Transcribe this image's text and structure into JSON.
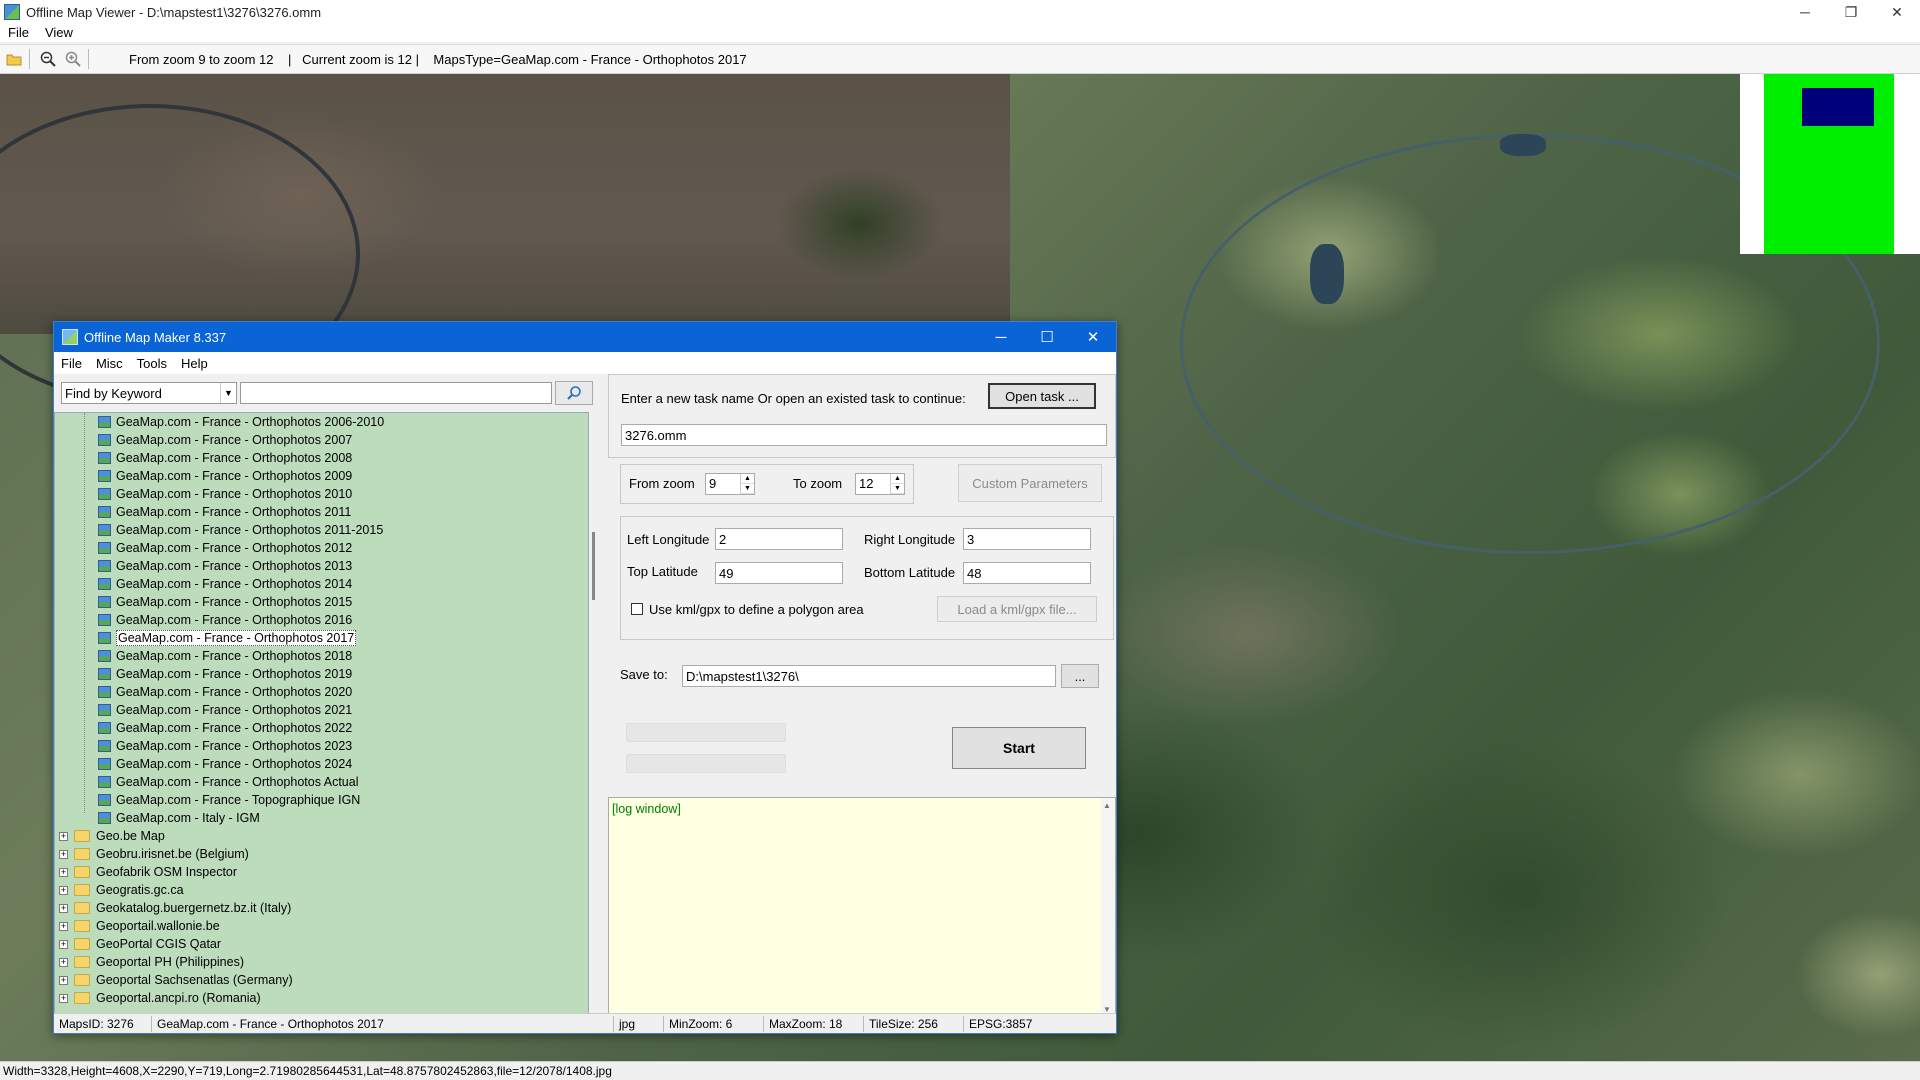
{
  "window": {
    "title": "Offline Map Viewer - D:\\mapstest1\\3276\\3276.omm",
    "controls": {
      "minimize": "─",
      "maximize": "❐",
      "close": "✕"
    }
  },
  "menu": {
    "file": "File",
    "view": "View"
  },
  "toolbar": {
    "info": "From zoom 9 to zoom 12    |   Current zoom is 12 |    MapsType=GeaMap.com - France - Orthophotos 2017"
  },
  "statusbar": {
    "text": "Width=3328,Height=4608,X=2290,Y=719,Long=2.71980285644531,Lat=48.8757802452863,file=12/2078/1408.jpg"
  },
  "colors": {
    "minimap_extent": "#00ee00",
    "minimap_view": "#00007a",
    "dialog_title": "#0a64d6",
    "tree_bg": "#bcdcbc",
    "log_bg": "#ffffe1"
  },
  "dialog": {
    "title": "Offline Map Maker 8.337",
    "controls": {
      "minimize": "─",
      "maximize": "☐",
      "close": "✕"
    },
    "menu": {
      "file": "File",
      "misc": "Misc",
      "tools": "Tools",
      "help": "Help"
    },
    "search": {
      "mode": "Find by Keyword",
      "keyword": ""
    },
    "tree": {
      "children": [
        "GeaMap.com - France - Orthophotos 2006-2010",
        "GeaMap.com - France - Orthophotos 2007",
        "GeaMap.com - France - Orthophotos 2008",
        "GeaMap.com - France - Orthophotos 2009",
        "GeaMap.com - France - Orthophotos 2010",
        "GeaMap.com - France - Orthophotos 2011",
        "GeaMap.com - France - Orthophotos 2011-2015",
        "GeaMap.com - France - Orthophotos 2012",
        "GeaMap.com - France - Orthophotos 2013",
        "GeaMap.com - France - Orthophotos 2014",
        "GeaMap.com - France - Orthophotos 2015",
        "GeaMap.com - France - Orthophotos 2016",
        "GeaMap.com - France - Orthophotos 2017",
        "GeaMap.com - France - Orthophotos 2018",
        "GeaMap.com - France - Orthophotos 2019",
        "GeaMap.com - France - Orthophotos 2020",
        "GeaMap.com - France - Orthophotos 2021",
        "GeaMap.com - France - Orthophotos 2022",
        "GeaMap.com - France - Orthophotos 2023",
        "GeaMap.com - France - Orthophotos 2024",
        "GeaMap.com - France - Orthophotos Actual",
        "GeaMap.com - France - Topographique IGN",
        "GeaMap.com - Italy - IGM"
      ],
      "selected": "GeaMap.com - France - Orthophotos 2017",
      "groups": [
        "Geo.be Map",
        "Geobru.irisnet.be (Belgium)",
        "Geofabrik OSM Inspector",
        "Geogratis.gc.ca",
        "Geokatalog.buergernetz.bz.it (Italy)",
        "Geoportail.wallonie.be",
        "GeoPortal CGIS Qatar",
        "Geoportal PH (Philippines)",
        "Geoportal Sachsenatlas (Germany)",
        "Geoportal.ancpi.ro (Romania)"
      ]
    },
    "task": {
      "prompt": "Enter a new task name Or open an existed task to continue:",
      "open_button": "Open task ...",
      "name": "3276.omm"
    },
    "zoom": {
      "from_label": "From zoom",
      "from_value": "9",
      "to_label": "To zoom",
      "to_value": "12",
      "custom_button": "Custom Parameters"
    },
    "bounds": {
      "left_label": "Left Longitude",
      "left_value": "2",
      "right_label": "Right Longitude",
      "right_value": "3",
      "top_label": "Top Latitude",
      "top_value": "49",
      "bottom_label": "Bottom Latitude",
      "bottom_value": "48",
      "kml_label": "Use kml/gpx to define a polygon area",
      "kml_button": "Load a kml/gpx file..."
    },
    "save": {
      "label": "Save to:",
      "path": "D:\\mapstest1\\3276\\",
      "browse": "..."
    },
    "start_button": "Start",
    "log": "[log window]",
    "status": {
      "maps_id": "MapsID: 3276",
      "maps_name": "GeaMap.com - France - Orthophotos 2017",
      "format": "jpg",
      "min_zoom": "MinZoom: 6",
      "max_zoom": "MaxZoom: 18",
      "tile_size": "TileSize: 256",
      "epsg": "EPSG:3857"
    }
  }
}
